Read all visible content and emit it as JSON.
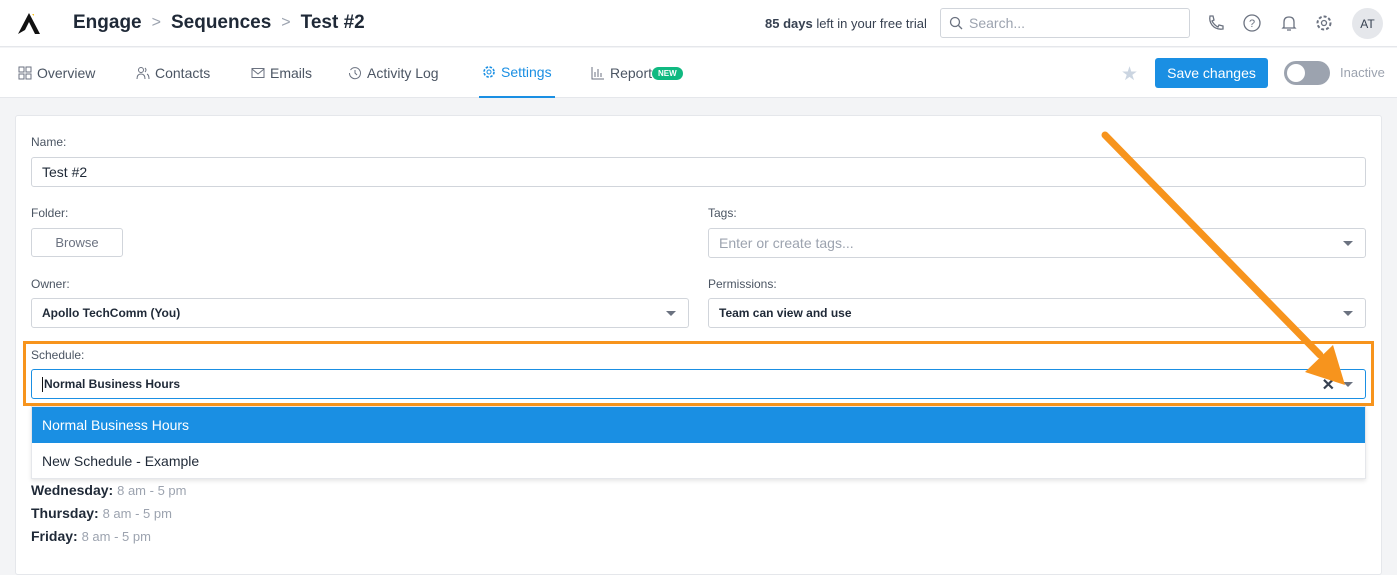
{
  "header": {
    "breadcrumb": [
      "Engage",
      "Sequences",
      "Test #2"
    ],
    "trial_days": "85 days",
    "trial_rest": " left in your free trial",
    "search_placeholder": "Search...",
    "avatar": "AT"
  },
  "tabs": [
    {
      "label": "Overview",
      "icon": "grid-icon"
    },
    {
      "label": "Contacts",
      "icon": "users-icon"
    },
    {
      "label": "Emails",
      "icon": "mail-icon"
    },
    {
      "label": "Activity Log",
      "icon": "history-icon"
    },
    {
      "label": "Settings",
      "icon": "gear-icon",
      "active": true
    },
    {
      "label": "Report",
      "icon": "bar-chart-icon",
      "badge": "NEW"
    }
  ],
  "toolbar": {
    "save_label": "Save changes",
    "status": "Inactive",
    "toggle_on": false
  },
  "form": {
    "name_label": "Name:",
    "name_value": "Test #2",
    "folder_label": "Folder:",
    "browse_label": "Browse",
    "tags_label": "Tags:",
    "tags_placeholder": "Enter or create tags...",
    "owner_label": "Owner:",
    "owner_value": "Apollo TechComm (You)",
    "permissions_label": "Permissions:",
    "permissions_value": "Team can view and use",
    "schedule_label": "Schedule:",
    "schedule_value": "Normal Business Hours",
    "schedule_options": [
      "Normal Business Hours",
      "New Schedule - Example"
    ],
    "days": [
      {
        "day": "Wednesday",
        "hours": "8 am - 5 pm"
      },
      {
        "day": "Thursday",
        "hours": "8 am - 5 pm"
      },
      {
        "day": "Friday",
        "hours": "8 am - 5 pm"
      }
    ]
  },
  "colors": {
    "accent": "#1a8fe3",
    "annotation": "#f7941d",
    "badge": "#10b981"
  }
}
